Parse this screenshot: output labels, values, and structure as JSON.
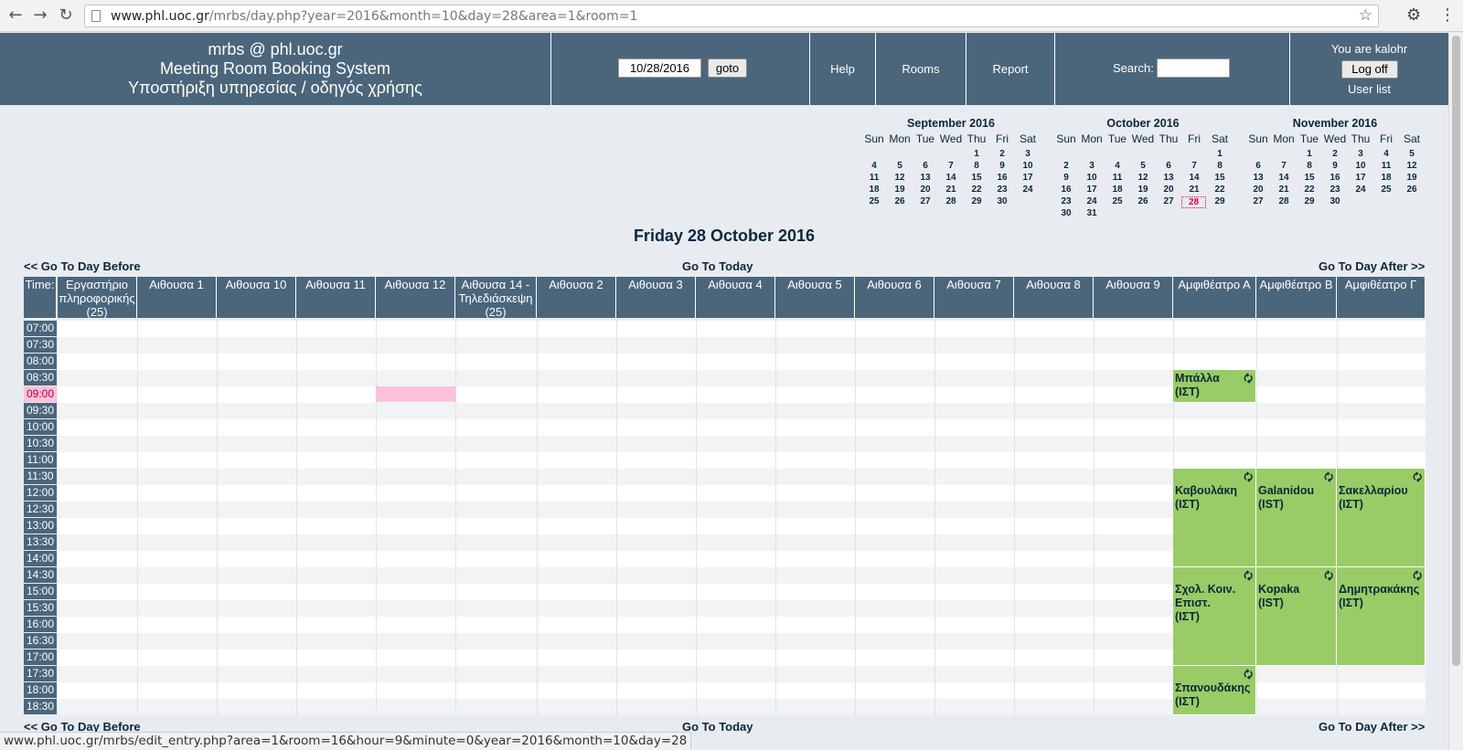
{
  "browser": {
    "back_icon": "←",
    "forward_icon": "→",
    "reload_icon": "↻",
    "url_host": "www.phl.uoc.gr",
    "url_path": "/mrbs/day.php?year=2016&month=10&day=28&area=1&room=1",
    "star_icon": "☆",
    "gear_icon": "⚙",
    "menu_icon": "⋮",
    "status_url": "www.phl.uoc.gr/mrbs/edit_entry.php?area=1&room=16&hour=9&minute=0&year=2016&month=10&day=28"
  },
  "header": {
    "brand_line1": "mrbs @ phl.uoc.gr",
    "brand_line2": "Meeting Room Booking System",
    "brand_line3": "Υποστήριξη υπηρεσίας / οδηγός χρήσης",
    "date_value": "10/28/2016",
    "goto_label": "goto",
    "help_label": "Help",
    "rooms_label": "Rooms",
    "report_label": "Report",
    "search_label": "Search:",
    "search_value": "",
    "user_text": "You are kalohr",
    "logoff_label": "Log off",
    "userlist_label": "User list",
    "colors": {
      "banner": "#4b667b",
      "booking": "#99cc66",
      "highlight": "#ffc0da"
    }
  },
  "calendars": [
    {
      "title": "September 2016",
      "dow": [
        "Sun",
        "Mon",
        "Tue",
        "Wed",
        "Thu",
        "Fri",
        "Sat"
      ],
      "first_weekday": 4,
      "days": 30,
      "today": null
    },
    {
      "title": "October 2016",
      "dow": [
        "Sun",
        "Mon",
        "Tue",
        "Wed",
        "Thu",
        "Fri",
        "Sat"
      ],
      "first_weekday": 6,
      "days": 31,
      "today": 28
    },
    {
      "title": "November 2016",
      "dow": [
        "Sun",
        "Mon",
        "Tue",
        "Wed",
        "Thu",
        "Fri",
        "Sat"
      ],
      "first_weekday": 2,
      "days": 30,
      "today": null
    }
  ],
  "day_title": "Friday 28 October 2016",
  "nav": {
    "before": "<< Go To Day Before",
    "today": "Go To Today",
    "after": "Go To Day After >>"
  },
  "grid": {
    "time_header": "Time:",
    "rooms": [
      "Εργαστήριο πληροφορικής (25)",
      "Αιθουσα 1",
      "Αιθουσα 10",
      "Αιθουσα 11",
      "Αιθουσα 12",
      "Αιθουσα 14 - Τηλεδιάσκεψη (25)",
      "Αιθουσα 2",
      "Αιθουσα 3",
      "Αιθουσα 4",
      "Αιθουσα 5",
      "Αιθουσα 6",
      "Αιθουσα 7",
      "Αιθουσα 8",
      "Αιθουσα 9",
      "Αμφιθέατρο Α",
      "Αμφιθέατρο Β",
      "Αμφιθέατρο Γ"
    ],
    "times": [
      "07:00",
      "07:30",
      "08:00",
      "08:30",
      "09:00",
      "09:30",
      "10:00",
      "10:30",
      "11:00",
      "11:30",
      "12:00",
      "12:30",
      "13:00",
      "13:30",
      "14:00",
      "14:30",
      "15:00",
      "15:30",
      "16:00",
      "16:30",
      "17:00",
      "17:30",
      "18:00",
      "18:30"
    ],
    "highlighted_time": "09:00",
    "selected_slot": {
      "room": "Αιθουσα 12",
      "time": "09:00"
    },
    "bookings": [
      {
        "room": "Αμφιθέατρο Α",
        "start": "08:30",
        "end": "09:30",
        "line1": "Μπάλλα",
        "line2": "(ΙΣΤ)",
        "repeat_icon": "🗘"
      },
      {
        "room": "Αμφιθέατρο Α",
        "start": "11:30",
        "end": "14:30",
        "line1": "Καβουλάκη",
        "line2": "(ΙΣΤ)",
        "repeat_icon": "🗘"
      },
      {
        "room": "Αμφιθέατρο Β",
        "start": "11:30",
        "end": "14:30",
        "line1": "Galanidou",
        "line2": "(IST)",
        "repeat_icon": "🗘"
      },
      {
        "room": "Αμφιθέατρο Γ",
        "start": "11:30",
        "end": "14:30",
        "line1": "Σακελλαρίου",
        "line2": "(ΙΣΤ)",
        "repeat_icon": "🗘"
      },
      {
        "room": "Αμφιθέατρο Α",
        "start": "14:30",
        "end": "17:30",
        "line1": "Σχολ. Κοιν. Επιστ.",
        "line2": "(ΙΣΤ)",
        "repeat_icon": "🗘"
      },
      {
        "room": "Αμφιθέατρο Β",
        "start": "14:30",
        "end": "17:30",
        "line1": "Kopaka",
        "line2": "(IST)",
        "repeat_icon": "🗘"
      },
      {
        "room": "Αμφιθέατρο Γ",
        "start": "14:30",
        "end": "17:30",
        "line1": "Δημητρακάκης",
        "line2": "(ΙΣΤ)",
        "repeat_icon": "🗘"
      },
      {
        "room": "Αμφιθέατρο Α",
        "start": "17:30",
        "end": "19:00",
        "line1": "Σπανουδάκης",
        "line2": "(ΙΣΤ)",
        "repeat_icon": "🗘"
      }
    ]
  }
}
